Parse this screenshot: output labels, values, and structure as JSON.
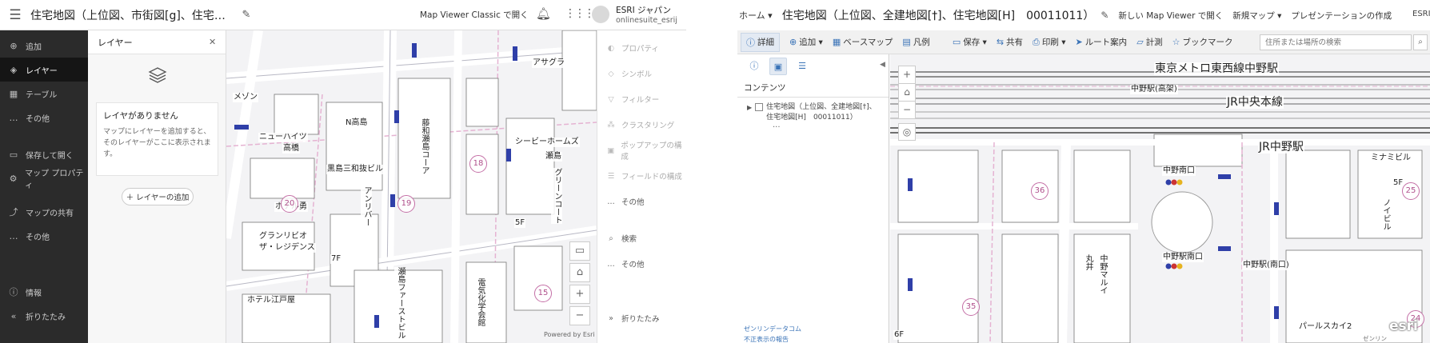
{
  "left": {
    "header": {
      "title": "住宅地図（上位図、市街図[g]、住宅地図[H]…",
      "classic_link": "Map Viewer Classic で開く",
      "user_name": "ESRI ジャパン",
      "user_id": "onlinesuite_esrij"
    },
    "nav": [
      {
        "icon": "⊕",
        "label": "追加"
      },
      {
        "icon": "◈",
        "label": "レイヤー"
      },
      {
        "icon": "▦",
        "label": "テーブル"
      },
      {
        "icon": "…",
        "label": "その他"
      },
      {
        "icon": "▭",
        "label": "保存して開く"
      },
      {
        "icon": "⚙",
        "label": "マップ プロパティ"
      },
      {
        "icon": "⤴",
        "label": "マップの共有"
      },
      {
        "icon": "…",
        "label": "その他"
      },
      {
        "icon": "ⓘ",
        "label": "情報"
      },
      {
        "icon": "«",
        "label": "折りたたみ"
      }
    ],
    "layer_panel": {
      "title": "レイヤー",
      "empty_title": "レイヤがありません",
      "empty_desc": "マップにレイヤーを追加すると、そのレイヤーがここに表示されます。",
      "add_button": "＋ レイヤーの追加"
    },
    "map_labels": {
      "a": "アサグラ",
      "b": "ニューハイツ",
      "c": "高橋",
      "d": "N高島",
      "e": "黒島三和抜ビル",
      "f": "ホテル勇",
      "g": "グランリビオ",
      "h": "ザ・レジデンス",
      "i": "ホテル江戸屋",
      "j": "シービーホームズ",
      "k": "瀬島",
      "l": "グリーンコート",
      "m": "瀬島ファーストビル",
      "n": "藤和瀬島コーア",
      "o": "アンリバー",
      "p": "電気化学会館",
      "q": "メゾン",
      "r": "7F",
      "s": "5F"
    },
    "map_circles": [
      "18",
      "19",
      "20",
      "15"
    ],
    "attribution": "Powered by Esri",
    "tools": [
      {
        "icon": "◐",
        "label": "プロパティ"
      },
      {
        "icon": "◇",
        "label": "シンボル"
      },
      {
        "icon": "▽",
        "label": "フィルター"
      },
      {
        "icon": "⁂",
        "label": "クラスタリング"
      },
      {
        "icon": "▣",
        "label": "ポップアップの構成"
      },
      {
        "icon": "☰",
        "label": "フィールドの構成"
      },
      {
        "icon": "…",
        "label": "その他"
      },
      {
        "icon": "⌕",
        "label": "検索"
      },
      {
        "icon": "…",
        "label": "その他"
      },
      {
        "icon": "»",
        "label": "折りたたみ"
      }
    ]
  },
  "right": {
    "header": {
      "home": "ホーム ▾",
      "title": "住宅地図（上位図、全建地図[†]、住宅地図[H]　00011011）",
      "new_viewer": "新しい Map Viewer で開く",
      "new_map": "新規マップ ▾",
      "presentation": "プレゼンテーションの作成",
      "user": "ESRI ▾"
    },
    "toolbar": [
      {
        "icon": "ⓘ",
        "label": "詳細"
      },
      {
        "icon": "⊕",
        "label": "追加 ▾"
      },
      {
        "icon": "▦",
        "label": "ベースマップ"
      },
      {
        "icon": "▤",
        "label": "凡例"
      },
      {
        "icon": "▭",
        "label": "保存 ▾"
      },
      {
        "icon": "⇆",
        "label": "共有"
      },
      {
        "icon": "⎙",
        "label": "印刷 ▾"
      },
      {
        "icon": "➤",
        "label": "ルート案内"
      },
      {
        "icon": "▱",
        "label": "計測"
      },
      {
        "icon": "☆",
        "label": "ブックマーク"
      }
    ],
    "search_placeholder": "住所または場所の検索",
    "sidebar": {
      "title": "コンテンツ",
      "layer": "住宅地図（上位図、全建地図[†]、住宅地図[H]　00011011）",
      "more": "···",
      "footer1": "ゼンリンデータコム",
      "footer2": "不正表示の報告"
    },
    "map_labels": {
      "a": "東京メトロ東西線中野駅",
      "b": "JR中央本線",
      "c": "JR中野駅",
      "d": "中野駅(高架)",
      "e": "中野南口",
      "f": "中野駅南口",
      "g": "丸井",
      "h": "中野マルイ",
      "i": "ミナミビル",
      "j": "ノイビル",
      "k": "中野駅(南口)",
      "l": "パールスカイ2",
      "m": "5F",
      "n": "6F"
    },
    "map_circles": [
      "36",
      "25",
      "35",
      "24"
    ],
    "attribution": "ゼンリン"
  }
}
